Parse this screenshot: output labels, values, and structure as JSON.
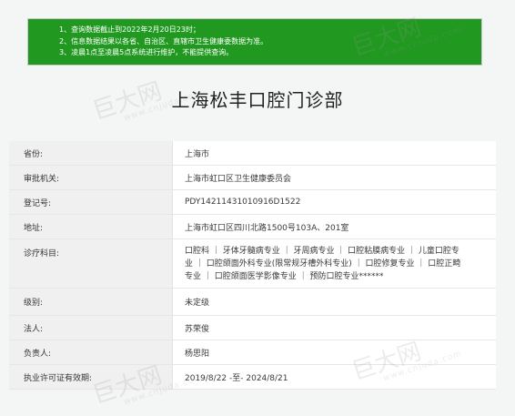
{
  "notice": {
    "lines": [
      "1、查询数据截止到2022年2月20日23时；",
      "2、信息数据结果以各省、自治区、直辖市卫生健康委数据为准。",
      "3、凌晨1点至凌晨5点系统进行维护，不能提供查询。"
    ]
  },
  "title": "上海松丰口腔门诊部",
  "rows": [
    {
      "label": "省份:",
      "value": "上海市"
    },
    {
      "label": "审批机关:",
      "value": "上海市虹口区卫生健康委员会"
    },
    {
      "label": "登记号:",
      "value": "PDY14211431010916D1522"
    },
    {
      "label": "地址:",
      "value": "上海市虹口区四川北路1500号103A、201室"
    },
    {
      "label": "诊疗科目:",
      "value_lines": [
        "口腔科 ｜ 牙体牙髓病专业 ｜ 牙周病专业 ｜ 口腔粘膜病专业 ｜ 儿童口腔专",
        "业 ｜ 口腔颌面外科专业(限常规牙槽外科专业) ｜ 口腔修复专业 ｜ 口腔正畸",
        "专业 ｜ 口腔颌面医学影像专业 ｜ 预防口腔专业******"
      ]
    },
    {
      "label": "级别:",
      "value": "未定级"
    },
    {
      "label": "法人:",
      "value": "苏荣俊"
    },
    {
      "label": "负责人:",
      "value": "杨思阳"
    },
    {
      "label": "执业许可证有效期:",
      "value": "2019/8/22 -至- 2024/8/21"
    }
  ],
  "watermark": {
    "brand": "巨大网",
    "url": "www.cnjuda.com"
  }
}
